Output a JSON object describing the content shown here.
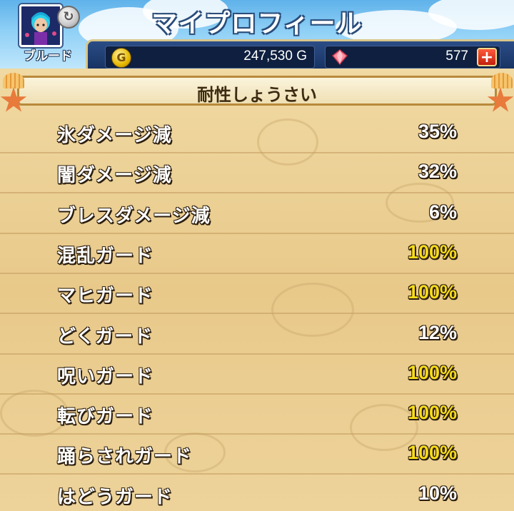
{
  "header": {
    "title": "マイプロフィール",
    "player_name": "ブルード",
    "avatar_icon": "player-avatar",
    "sync_icon": "refresh-icon"
  },
  "currency": {
    "gold_icon": "G",
    "gold_value": "247,530 G",
    "gem_value": "577",
    "plus_label": "+"
  },
  "panel": {
    "title": "耐性しょうさい"
  },
  "colors": {
    "max_value": "#f7dc1a",
    "normal_value": "#ffffff"
  },
  "resistances": [
    {
      "label": "氷ダメージ減",
      "value": "35%",
      "max": false
    },
    {
      "label": "闇ダメージ減",
      "value": "32%",
      "max": false
    },
    {
      "label": "ブレスダメージ減",
      "value": "6%",
      "max": false
    },
    {
      "label": "混乱ガード",
      "value": "100%",
      "max": true
    },
    {
      "label": "マヒガード",
      "value": "100%",
      "max": true
    },
    {
      "label": "どくガード",
      "value": "12%",
      "max": false
    },
    {
      "label": "呪いガード",
      "value": "100%",
      "max": true
    },
    {
      "label": "転びガード",
      "value": "100%",
      "max": true
    },
    {
      "label": "踊らされガード",
      "value": "100%",
      "max": true
    },
    {
      "label": "はどうガード",
      "value": "10%",
      "max": false
    }
  ]
}
